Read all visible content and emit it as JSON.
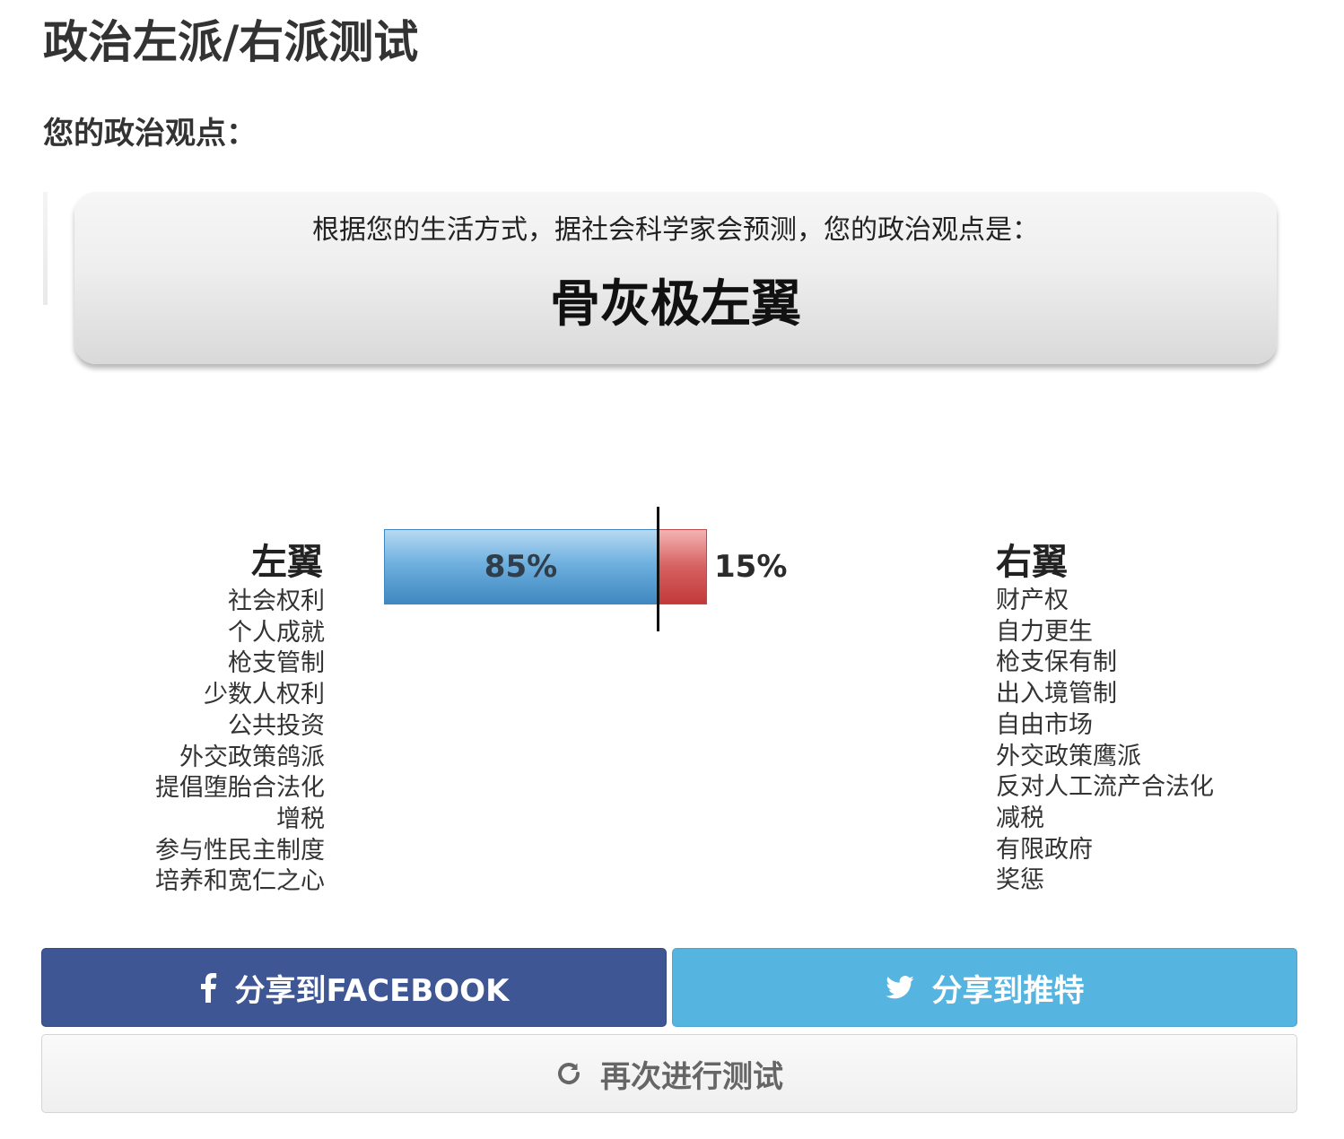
{
  "page": {
    "title": "政治左派/右派测试",
    "subtitle": "您的政治观点："
  },
  "result": {
    "intro": "根据您的生活方式，据社会科学家会预测，您的政治观点是：",
    "label": "骨灰极左翼"
  },
  "meter": {
    "left_percent": 85,
    "right_percent": 15,
    "left_label": "85%",
    "right_label": "15%",
    "left_color": "#3f88c0",
    "right_color": "#c23a3a"
  },
  "left_wing": {
    "title": "左翼",
    "items": [
      "社会权利",
      "个人成就",
      "枪支管制",
      "少数人权利",
      "公共投资",
      "外交政策鸽派",
      "提倡堕胎合法化",
      "增税",
      "参与性民主制度",
      "培养和宽仁之心"
    ]
  },
  "right_wing": {
    "title": "右翼",
    "items": [
      "财产权",
      "自力更生",
      "枪支保有制",
      "出入境管制",
      "自由市场",
      "外交政策鹰派",
      "反对人工流产合法化",
      "减税",
      "有限政府",
      "奖惩"
    ]
  },
  "buttons": {
    "facebook_label": "分享到FACEBOOK",
    "twitter_label": "分享到推特",
    "retake_label": "再次进行测试",
    "facebook_icon": "facebook-icon",
    "twitter_icon": "twitter-icon",
    "retake_icon": "refresh-icon",
    "facebook_color": "#3f5694",
    "twitter_color": "#56b4e0"
  }
}
